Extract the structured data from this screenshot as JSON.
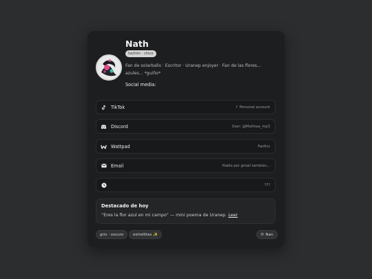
{
  "profile": {
    "name": "Nath",
    "pronouns": "he/him · chico",
    "bio": "Fan de solarballs · Escritor · Uranep enjoyer · Fan de las flores... azules... *guiño*",
    "social_title": "Social media:"
  },
  "links": [
    {
      "icon": "tiktok-icon",
      "label": "TikTok",
      "value": "↑ Personal account"
    },
    {
      "icon": "discord-icon",
      "label": "Discord",
      "value": "User: @Mathiaa_mp3"
    },
    {
      "icon": "wattpad-icon",
      "label": "Wattpad",
      "value": "Fanfics"
    },
    {
      "icon": "email-icon",
      "label": "Email",
      "value": "Hablo por gmail también..."
    },
    {
      "icon": "clock-icon",
      "label": "",
      "value": "???"
    }
  ],
  "featured": {
    "title": "Destacado de hoy",
    "text": "“Eres la flor azul en mi campo” — mini poema de Uranep.",
    "link": "Leer"
  },
  "tags": [
    "gris · oscuro",
    "estrellitas ✨"
  ],
  "footer_badge": "© Nan",
  "colors": {
    "background": "#2c2d2f",
    "card": "#1d1e20",
    "badge": "#d4d4d4"
  }
}
